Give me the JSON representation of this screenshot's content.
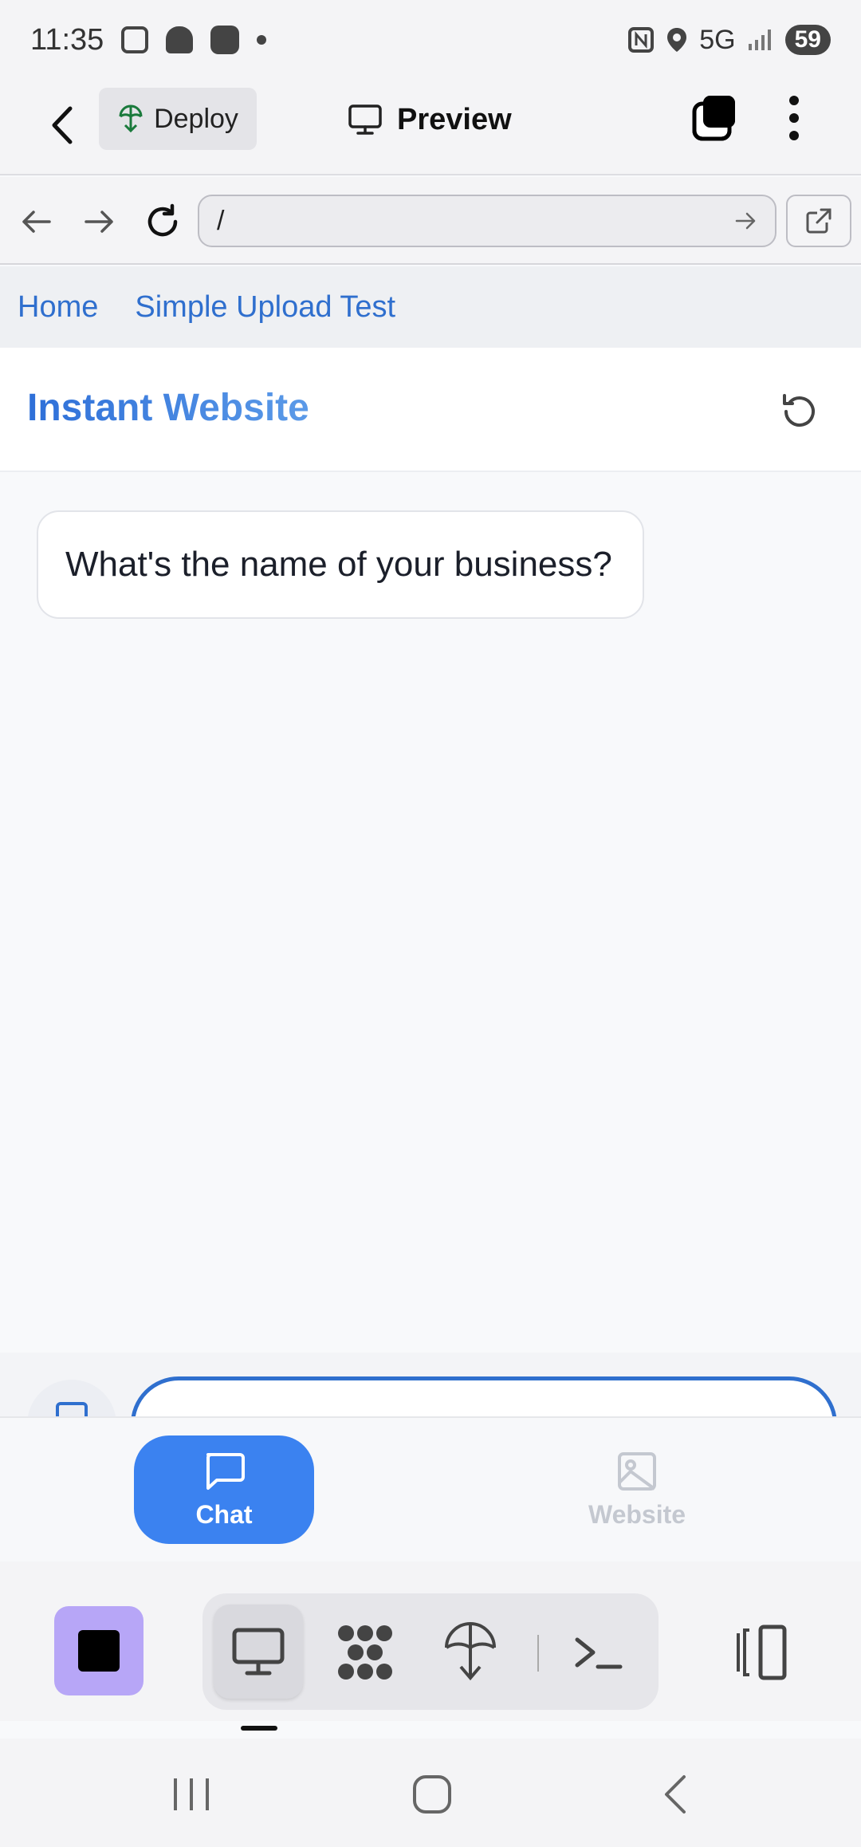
{
  "status_bar": {
    "time": "11:35",
    "network": "5G",
    "battery": "59",
    "icons": [
      "screenshot-icon",
      "snapchat-icon",
      "app-icon",
      "dot-icon",
      "nfc-icon",
      "location-icon",
      "signal-icon"
    ]
  },
  "app_header": {
    "deploy_label": "Deploy",
    "preview_label": "Preview"
  },
  "browser": {
    "url": "/"
  },
  "site_nav": {
    "links": [
      "Home",
      "Simple Upload Test"
    ]
  },
  "site_header": {
    "title": "Instant Website"
  },
  "chat": {
    "messages": [
      {
        "role": "assistant",
        "text": "What's the name of your business?"
      }
    ],
    "input_value": ""
  },
  "bottom_tabs": {
    "chat_label": "Chat",
    "website_label": "Website",
    "active": "Chat"
  },
  "colors": {
    "accent": "#3b82f0",
    "link": "#2f6fce",
    "stop_button": "#b7a6f7"
  }
}
